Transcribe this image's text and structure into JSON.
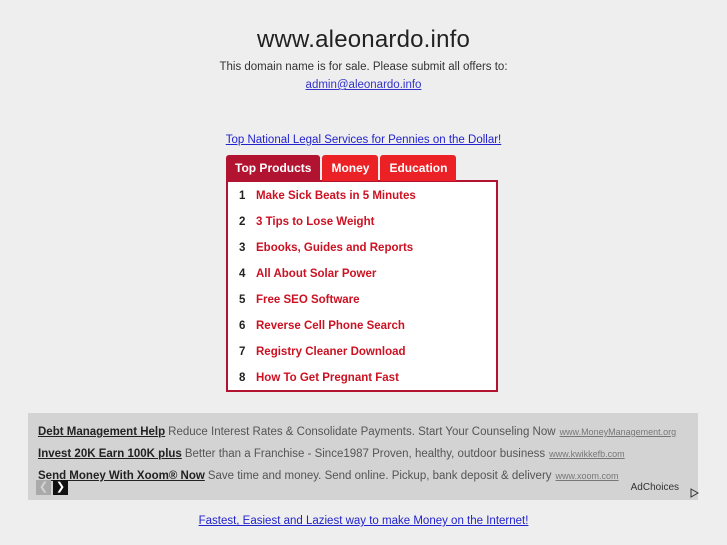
{
  "page": {
    "background_color": "#eeeeee"
  },
  "header": {
    "domain": "www.aleonardo.info",
    "subtitle": "This domain name is for sale. Please submit all offers to:",
    "email": "admin@aleonardo.info",
    "link_color": "#3333cc"
  },
  "promo_top": {
    "text": "Top National Legal Services for Pennies on the Dollar!"
  },
  "widget": {
    "active_tab_color": "#b21330",
    "inactive_tab_color": "#ec2126",
    "tabs": [
      {
        "label": "Top Products",
        "active": true
      },
      {
        "label": "Money",
        "active": false
      },
      {
        "label": "Education",
        "active": false
      }
    ],
    "products": [
      {
        "rank": "1",
        "title": "Make Sick Beats in 5 Minutes"
      },
      {
        "rank": "2",
        "title": "3 Tips to Lose Weight"
      },
      {
        "rank": "3",
        "title": "Ebooks, Guides and Reports"
      },
      {
        "rank": "4",
        "title": "All About Solar Power"
      },
      {
        "rank": "5",
        "title": "Free SEO Software"
      },
      {
        "rank": "6",
        "title": "Reverse Cell Phone Search"
      },
      {
        "rank": "7",
        "title": "Registry Cleaner Download"
      },
      {
        "rank": "8",
        "title": "How To Get Pregnant Fast"
      }
    ]
  },
  "ads": {
    "background_color": "#d3d3d3",
    "items": [
      {
        "title": "Debt Management Help",
        "description": "Reduce Interest Rates & Consolidate Payments. Start Your Counseling Now",
        "url": "www.MoneyManagement.org"
      },
      {
        "title": "Invest 20K Earn 100K plus",
        "description": "Better than a Franchise - Since1987 Proven, healthy, outdoor business",
        "url": "www.kwikkefb.com"
      },
      {
        "title": "Send Money With Xoom® Now",
        "description": "Save time and money. Send online. Pickup, bank deposit & delivery",
        "url": "www.xoom.com"
      }
    ],
    "nav": {
      "prev_icon": "chevron-left-icon",
      "prev_glyph": "❮",
      "prev_enabled": false,
      "next_icon": "chevron-right-icon",
      "next_glyph": "❯",
      "next_enabled": true
    },
    "adchoices_label": "AdChoices",
    "adchoices_icon": "adchoices-triangle-icon"
  },
  "promo_bottom": {
    "text": "Fastest, Easiest and Laziest way to make Money on the Internet!"
  }
}
